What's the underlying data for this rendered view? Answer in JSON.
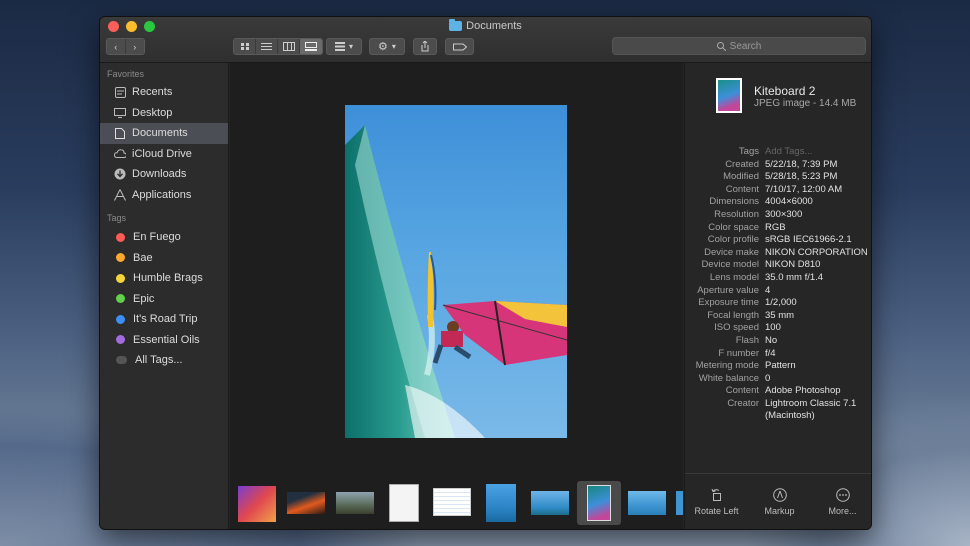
{
  "window": {
    "title": "Documents"
  },
  "toolbar": {
    "back_icon": "chevron-left",
    "forward_icon": "chevron-right",
    "search_placeholder": "Search",
    "view_modes": [
      "icon-view",
      "list-view",
      "column-view",
      "gallery-view"
    ],
    "active_view": "gallery-view"
  },
  "sidebar": {
    "favorites_heading": "Favorites",
    "favorites": [
      {
        "label": "Recents",
        "icon": "clock-icon"
      },
      {
        "label": "Desktop",
        "icon": "desktop-icon"
      },
      {
        "label": "Documents",
        "icon": "document-icon",
        "selected": true
      },
      {
        "label": "iCloud Drive",
        "icon": "cloud-icon"
      },
      {
        "label": "Downloads",
        "icon": "download-icon"
      },
      {
        "label": "Applications",
        "icon": "applications-icon"
      }
    ],
    "tags_heading": "Tags",
    "tags": [
      {
        "label": "En Fuego",
        "color": "#ff5c57"
      },
      {
        "label": "Bae",
        "color": "#ffa82e"
      },
      {
        "label": "Humble Brags",
        "color": "#f5d53a"
      },
      {
        "label": "Epic",
        "color": "#62d04a"
      },
      {
        "label": "It's Road Trip",
        "color": "#3b8ff5"
      },
      {
        "label": "Essential Oils",
        "color": "#a46be0"
      },
      {
        "label": "All Tags...",
        "color": "#555555"
      }
    ]
  },
  "inspector": {
    "file_name": "Kiteboard 2",
    "file_kind": "JPEG image - 14.4 MB",
    "metadata": [
      {
        "key": "Tags",
        "value": "Add Tags...",
        "placeholder": true
      },
      {
        "key": "Created",
        "value": "5/22/18, 7:39 PM"
      },
      {
        "key": "Modified",
        "value": "5/28/18, 5:23 PM"
      },
      {
        "key": "Content",
        "value": "7/10/17, 12:00 AM"
      },
      {
        "key": "Dimensions",
        "value": "4004×6000"
      },
      {
        "key": "Resolution",
        "value": "300×300"
      },
      {
        "key": "Color space",
        "value": "RGB"
      },
      {
        "key": "Color profile",
        "value": "sRGB IEC61966-2.1"
      },
      {
        "key": "Device make",
        "value": "NIKON CORPORATION"
      },
      {
        "key": "Device model",
        "value": "NIKON D810"
      },
      {
        "key": "Lens model",
        "value": "35.0 mm f/1.4"
      },
      {
        "key": "Aperture value",
        "value": "4"
      },
      {
        "key": "Exposure time",
        "value": "1/2,000"
      },
      {
        "key": "Focal length",
        "value": "35 mm"
      },
      {
        "key": "ISO speed",
        "value": "100"
      },
      {
        "key": "Flash",
        "value": "No"
      },
      {
        "key": "F number",
        "value": "f/4"
      },
      {
        "key": "Metering mode",
        "value": "Pattern"
      },
      {
        "key": "White balance",
        "value": "0"
      },
      {
        "key": "Content",
        "value": "Adobe Photoshop"
      },
      {
        "key": "Creator",
        "value": "Lightroom Classic 7.1 (Macintosh)"
      }
    ],
    "actions": [
      {
        "label": "Rotate Left",
        "icon": "rotate-left-icon"
      },
      {
        "label": "Markup",
        "icon": "markup-icon"
      },
      {
        "label": "More...",
        "icon": "more-icon"
      }
    ]
  },
  "thumbnail_strip": {
    "selected_index": 7
  }
}
